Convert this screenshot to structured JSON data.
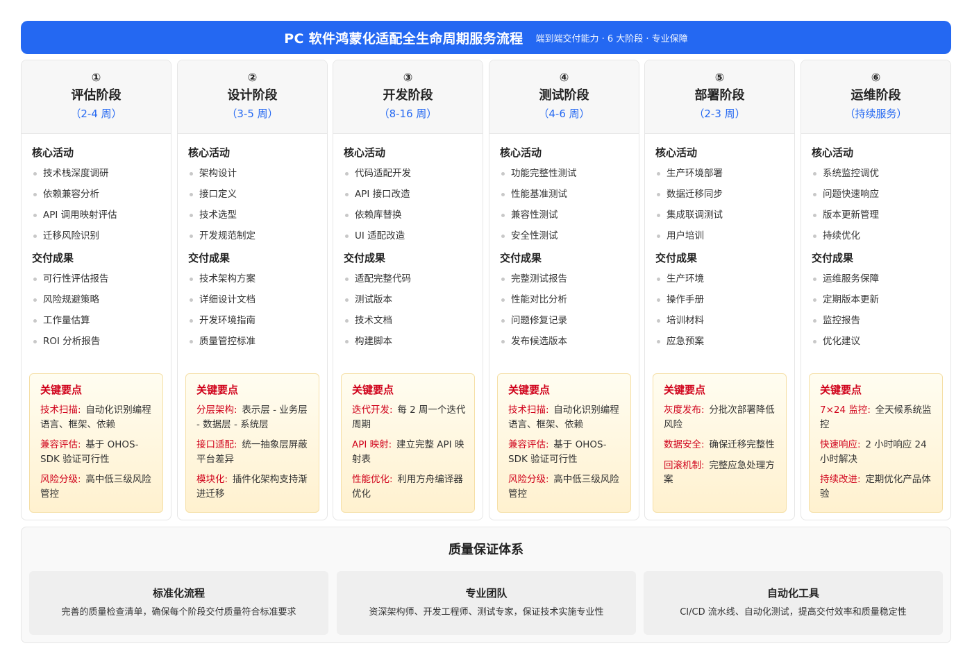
{
  "header": {
    "title": "PC 软件鸿蒙化适配全生命周期服务流程",
    "subtitle": "端到端交付能力 · 6 大阶段 · 专业保障"
  },
  "labels": {
    "core_activities": "核心活动",
    "deliverables": "交付成果",
    "key_points": "关键要点"
  },
  "stages": [
    {
      "num": "①",
      "name": "评估阶段",
      "duration": "（2-4 周）",
      "activities": [
        "技术栈深度调研",
        "依赖兼容分析",
        "API 调用映射评估",
        "迁移风险识别"
      ],
      "deliverables": [
        "可行性评估报告",
        "风险规避策略",
        "工作量估算",
        "ROI 分析报告"
      ],
      "key_points": [
        {
          "label": "技术扫描:",
          "text": "自动化识别编程语言、框架、依赖"
        },
        {
          "label": "兼容评估:",
          "text": "基于 OHOS-SDK 验证可行性"
        },
        {
          "label": "风险分级:",
          "text": "高中低三级风险管控"
        }
      ]
    },
    {
      "num": "②",
      "name": "设计阶段",
      "duration": "（3-5 周）",
      "activities": [
        "架构设计",
        "接口定义",
        "技术选型",
        "开发规范制定"
      ],
      "deliverables": [
        "技术架构方案",
        "详细设计文档",
        "开发环境指南",
        "质量管控标准"
      ],
      "key_points": [
        {
          "label": "分层架构:",
          "text": "表示层 - 业务层 - 数据层 - 系统层"
        },
        {
          "label": "接口适配:",
          "text": "统一抽象层屏蔽平台差异"
        },
        {
          "label": "模块化:",
          "text": "插件化架构支持渐进迁移"
        }
      ]
    },
    {
      "num": "③",
      "name": "开发阶段",
      "duration": "（8-16 周）",
      "activities": [
        "代码适配开发",
        "API 接口改造",
        "依赖库替换",
        "UI 适配改造"
      ],
      "deliverables": [
        "适配完整代码",
        "测试版本",
        "技术文档",
        "构建脚本"
      ],
      "key_points": [
        {
          "label": "迭代开发:",
          "text": "每 2 周一个迭代周期"
        },
        {
          "label": "API 映射:",
          "text": "建立完整 API 映射表"
        },
        {
          "label": "性能优化:",
          "text": "利用方舟编译器优化"
        }
      ]
    },
    {
      "num": "④",
      "name": "测试阶段",
      "duration": "（4-6 周）",
      "activities": [
        "功能完整性测试",
        "性能基准测试",
        "兼容性测试",
        "安全性测试"
      ],
      "deliverables": [
        "完整测试报告",
        "性能对比分析",
        "问题修复记录",
        "发布候选版本"
      ],
      "key_points": [
        {
          "label": "技术扫描:",
          "text": "自动化识别编程语言、框架、依赖"
        },
        {
          "label": "兼容评估:",
          "text": "基于 OHOS-SDK 验证可行性"
        },
        {
          "label": "风险分级:",
          "text": "高中低三级风险管控"
        }
      ]
    },
    {
      "num": "⑤",
      "name": "部署阶段",
      "duration": "（2-3 周）",
      "activities": [
        "生产环境部署",
        "数据迁移同步",
        "集成联调测试",
        "用户培训"
      ],
      "deliverables": [
        "生产环境",
        "操作手册",
        "培训材料",
        "应急预案"
      ],
      "key_points": [
        {
          "label": "灰度发布:",
          "text": "分批次部署降低风险"
        },
        {
          "label": "数据安全:",
          "text": "确保迁移完整性"
        },
        {
          "label": "回滚机制:",
          "text": "完整应急处理方案"
        }
      ]
    },
    {
      "num": "⑥",
      "name": "运维阶段",
      "duration": "（持续服务）",
      "activities": [
        "系统监控调优",
        "问题快速响应",
        "版本更新管理",
        "持续优化"
      ],
      "deliverables": [
        "运维服务保障",
        "定期版本更新",
        "监控报告",
        "优化建议"
      ],
      "key_points": [
        {
          "label": "7×24 监控:",
          "text": "全天候系统监控"
        },
        {
          "label": "快速响应:",
          "text": "2 小时响应 24 小时解决"
        },
        {
          "label": "持续改进:",
          "text": "定期优化产品体验"
        }
      ]
    }
  ],
  "qa": {
    "title": "质量保证体系",
    "cards": [
      {
        "title": "标准化流程",
        "desc": "完善的质量检查清单，确保每个阶段交付质量符合标准要求"
      },
      {
        "title": "专业团队",
        "desc": "资深架构师、开发工程师、测试专家，保证技术实施专业性"
      },
      {
        "title": "自动化工具",
        "desc": "CI/CD 流水线、自动化测试，提高交付效率和质量稳定性"
      }
    ]
  },
  "colors": {
    "primary": "#2468f2",
    "key_point_red": "#d0021b",
    "key_point_bg": "#fff6dc"
  }
}
